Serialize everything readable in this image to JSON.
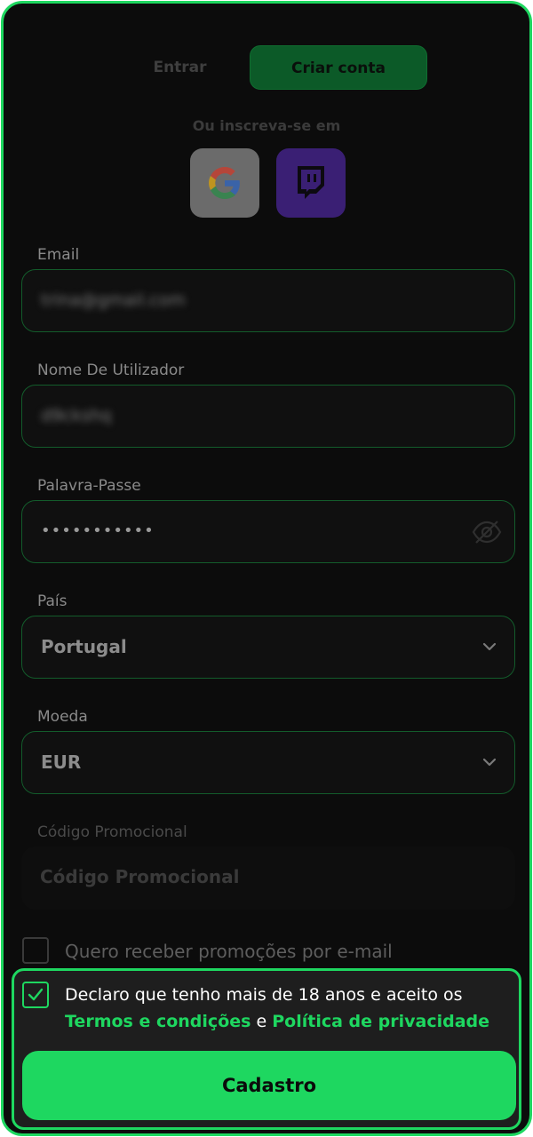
{
  "tabs": {
    "login": "Entrar",
    "register": "Criar conta"
  },
  "social": {
    "subtitle": "Ou inscreva-se em"
  },
  "email": {
    "label": "Email",
    "value": "trina@gmail.com"
  },
  "username": {
    "label": "Nome De Utilizador",
    "value": "d9ckshq"
  },
  "password": {
    "label": "Palavra-Passe",
    "value": "•••••••••••"
  },
  "country": {
    "label": "País",
    "value": "Portugal"
  },
  "currency": {
    "label": "Moeda",
    "value": "EUR"
  },
  "promo": {
    "label": "Código Promocional",
    "placeholder": "Código Promocional"
  },
  "newsletter": {
    "label": "Quero receber promoções por e-mail",
    "checked": false
  },
  "consent": {
    "line1": "Declaro que tenho mais de 18 anos e aceito os",
    "terms": "Termos e condições",
    "joiner": "e",
    "privacy": "Política de privacidade",
    "checked": true
  },
  "submit": {
    "label": "Cadastro"
  },
  "colors": {
    "accent": "#1ed760",
    "background": "#0c0c0c",
    "twitch": "#3a1f74"
  },
  "icons": [
    "google-icon",
    "twitch-icon",
    "eye-off-icon",
    "chevron-down-icon",
    "checkmark-icon"
  ]
}
